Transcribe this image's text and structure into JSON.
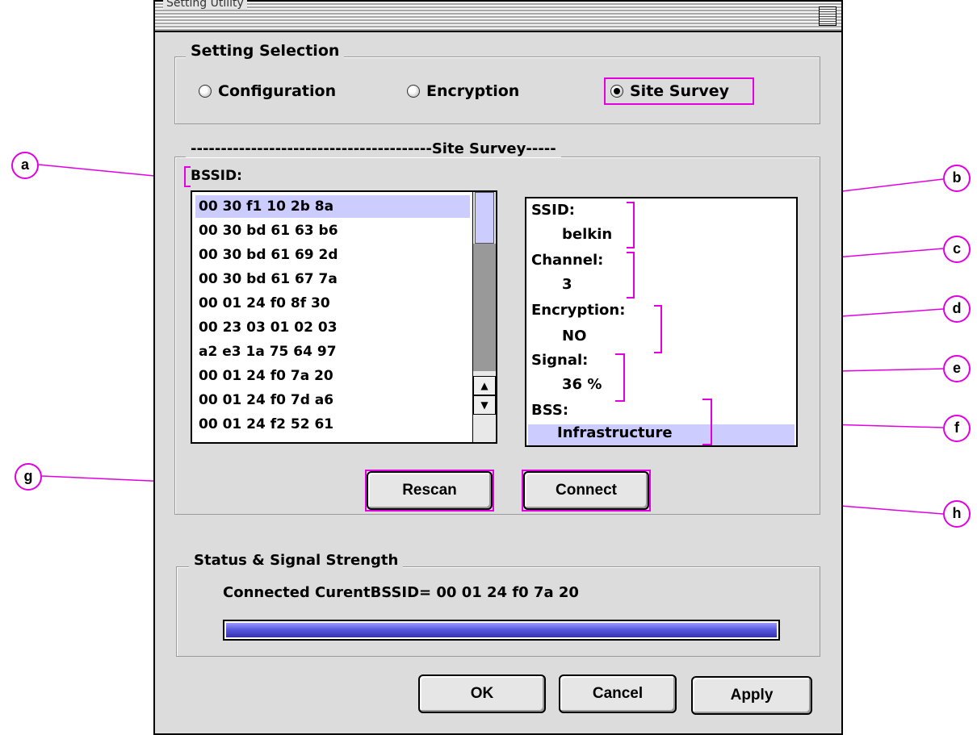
{
  "window": {
    "title": "Setting Utility"
  },
  "setting_selection": {
    "label": "Setting Selection",
    "options": [
      "Configuration",
      "Encryption",
      "Site Survey"
    ],
    "selected": "Site Survey"
  },
  "site_survey": {
    "group_label": "----------------------------------------Site Survey-----",
    "bssid_label": "BSSID:",
    "bssid_list": [
      "00 30 f1 10 2b 8a",
      "00 30 bd 61 63 b6",
      "00 30 bd 61 69 2d",
      "00 30 bd 61 67 7a",
      "00 01 24 f0 8f 30",
      "00 23 03 01 02 03",
      "a2 e3 1a 75 64 97",
      "00 01 24 f0 7a 20",
      "00 01 24 f0 7d a6",
      "00 01 24 f2 52 61"
    ],
    "selected_index": 0,
    "details": {
      "ssid_label": "SSID:",
      "ssid_value": "belkin",
      "channel_label": "Channel:",
      "channel_value": "3",
      "encryption_label": "Encryption:",
      "encryption_value": "NO",
      "signal_label": "Signal:",
      "signal_value": "36 %",
      "bss_label": "BSS:",
      "bss_value": "Infrastructure"
    },
    "rescan_label": "Rescan",
    "connect_label": "Connect"
  },
  "status": {
    "label": "Status & Signal Strength",
    "text": "Connected  CurentBSSID= 00 01 24 f0 7a 20",
    "signal_fraction": 1.0,
    "bar_color": "#5555dd"
  },
  "footer": {
    "ok_label": "OK",
    "cancel_label": "Cancel",
    "apply_label": "Apply"
  },
  "callouts": [
    "a",
    "b",
    "c",
    "d",
    "e",
    "f",
    "g",
    "h"
  ],
  "annotation_color": "#e000e0"
}
